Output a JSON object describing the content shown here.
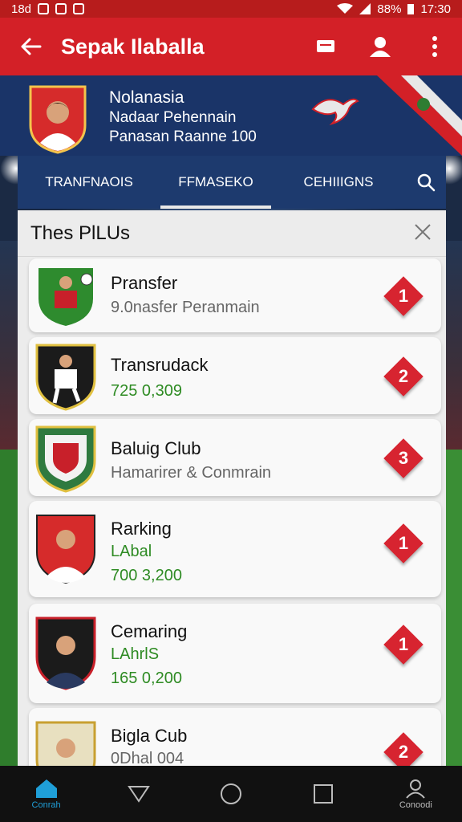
{
  "status_bar": {
    "left_text": "18d",
    "battery": "88%",
    "time": "17:30"
  },
  "app_bar": {
    "title": "Sepak Ilaballa"
  },
  "team": {
    "name": "Nolanasia",
    "line2": "Nadaar Pehennain",
    "line3": "Panasan Raanne 100"
  },
  "tabs": [
    {
      "label": "TRANFNAOIS"
    },
    {
      "label": "FFMASEKO"
    },
    {
      "label": "CEHIIIGNS"
    }
  ],
  "panel": {
    "title": "Thes PlLUs"
  },
  "list": [
    {
      "title": "Pransfer",
      "sub1": "9.0nasfer Peranmain",
      "sub1_color": "gray",
      "rank": "1"
    },
    {
      "title": "Transrudack",
      "sub1": "725 0,309",
      "sub1_color": "green",
      "rank": "2"
    },
    {
      "title": "Baluig Club",
      "sub1": "Hamarirer & Conmrain",
      "sub1_color": "gray",
      "rank": "3"
    },
    {
      "title": "Rarking",
      "sub1": "LAbal",
      "sub1_color": "green",
      "sub2": "700 3,200",
      "rank": "1"
    },
    {
      "title": "Cemaring",
      "sub1": "LAhrlS",
      "sub1_color": "green",
      "sub2": "165 0,200",
      "rank": "1"
    },
    {
      "title": "Bigla Cub",
      "sub1": "0Dhal 004",
      "sub1_color": "gray",
      "rank": "2"
    }
  ],
  "navbar": {
    "home_label": "Conrah",
    "profile_label": "Conoodi"
  },
  "colors": {
    "primary_red": "#d32027",
    "navy": "#1a3468",
    "green_text": "#2e8b23"
  },
  "icons": [
    "back-arrow-icon",
    "message-icon",
    "person-icon",
    "more-vert-icon",
    "search-icon",
    "close-icon",
    "home-icon",
    "triangle-back-icon",
    "circle-home-icon",
    "square-recents-icon",
    "profile-icon"
  ]
}
